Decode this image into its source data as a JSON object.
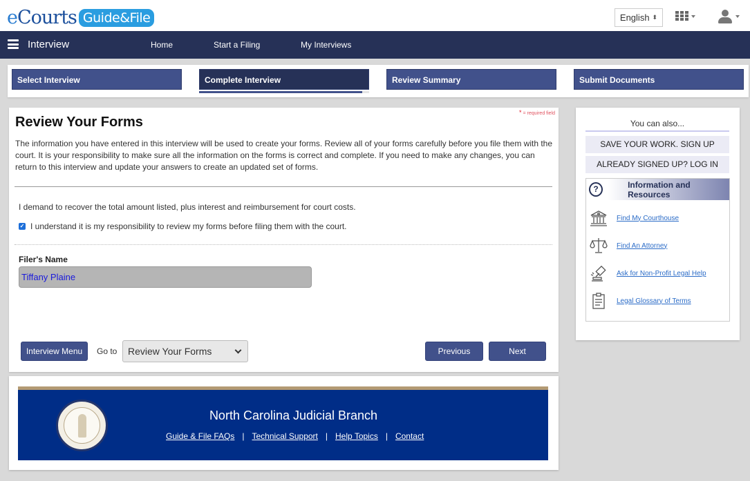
{
  "header": {
    "logo_part1": "Courts",
    "logo_e": "e",
    "logo_part2": "Guide&File",
    "language": "English",
    "apps_icon": "grid-icon",
    "user_icon": "user-icon"
  },
  "nav": {
    "menu_icon": "hamburger-icon",
    "title": "Interview",
    "links": [
      "Home",
      "Start a Filing",
      "My Interviews"
    ]
  },
  "steps": {
    "items": [
      {
        "label": "Select Interview",
        "active": false
      },
      {
        "label": "Complete Interview",
        "active": true
      },
      {
        "label": "Review Summary",
        "active": false
      },
      {
        "label": "Submit Documents",
        "active": false
      }
    ],
    "progress_percent": 96
  },
  "main": {
    "required_note_star": "*",
    "required_note": " = required field",
    "title": "Review Your Forms",
    "intro": "The information you have entered in this interview will be used to create your forms. Review all of your forms carefully before you file them with the court. It is your responsibility to make sure all the information on the forms is correct and complete. If you need to make any changes, you can return to this interview and update your answers to create an updated set of forms.",
    "demand_text": "I demand to recover the total amount listed, plus interest and reimbursement for court costs.",
    "acknowledge_text": "I understand it is my responsibility to review my forms before filing them with the court.",
    "acknowledge_checked": true,
    "filer_label": "Filer's Name",
    "filer_value": "Tiffany Plaine",
    "interview_menu_label": "Interview Menu",
    "goto_label": "Go to",
    "goto_value": "Review Your Forms",
    "previous_label": "Previous",
    "next_label": "Next"
  },
  "sidebar": {
    "heading": "You can also...",
    "signup_label": "SAVE YOUR WORK. SIGN UP",
    "login_label": "ALREADY SIGNED UP? LOG IN",
    "info_title": "Information and Resources",
    "info_icon": "?",
    "resources": [
      {
        "icon": "courthouse-icon",
        "label": "Find My Courthouse"
      },
      {
        "icon": "scales-icon",
        "label": "Find An Attorney"
      },
      {
        "icon": "gavel-icon",
        "label": "Ask for Non-Profit Legal Help"
      },
      {
        "icon": "clipboard-icon",
        "label": "Legal Glossary of Terms"
      }
    ]
  },
  "footer": {
    "title": "North Carolina Judicial Branch",
    "links": [
      "Guide & File FAQs",
      "Technical Support",
      "Help Topics",
      "Contact"
    ],
    "separator": "|"
  },
  "colors": {
    "navy": "#263157",
    "step_blue": "#41518b",
    "footer_blue": "#002d87",
    "footer_gold": "#b39a73",
    "link_blue": "#2a6bc7"
  }
}
